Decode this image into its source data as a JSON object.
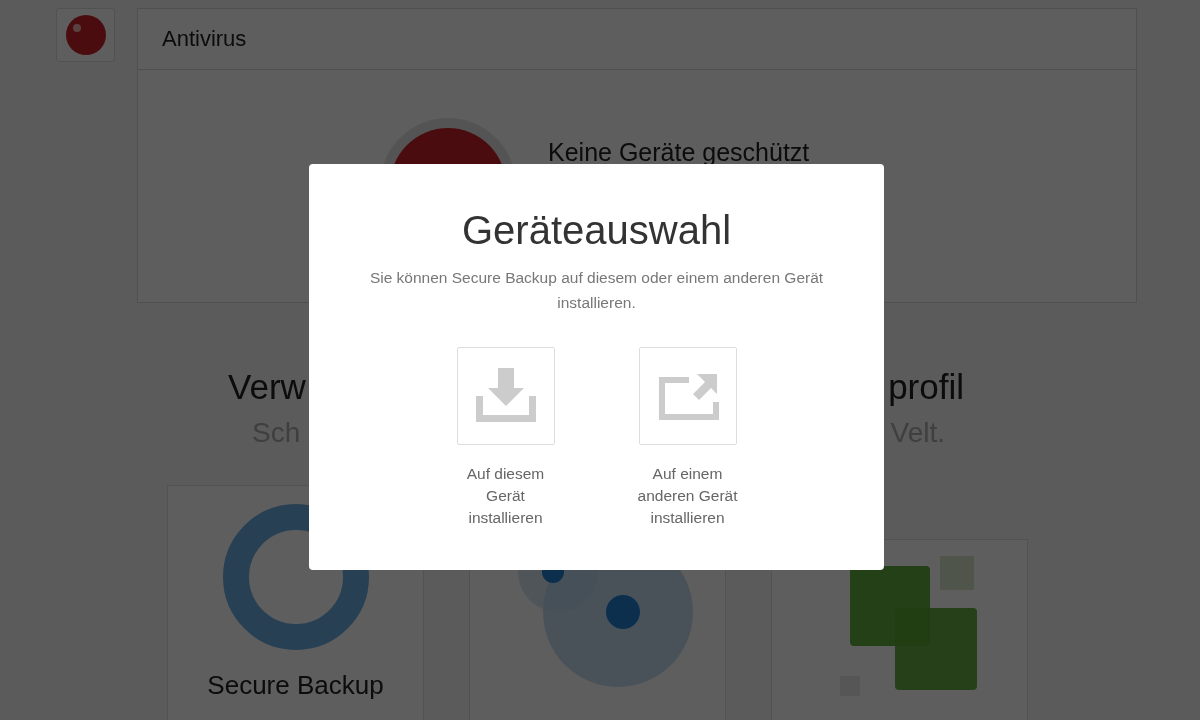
{
  "antivirus_card": {
    "title": "Antivirus",
    "status": "Keine Geräte geschützt"
  },
  "promo": {
    "heading_fragments": [
      "Verw",
      "profil"
    ],
    "subheading_fragments": [
      "Sch",
      "Velt."
    ]
  },
  "product_cards": [
    {
      "kind": "donut",
      "title": "Secure Backup"
    },
    {
      "kind": "bubbles"
    },
    {
      "kind": "squares"
    }
  ],
  "dialog": {
    "title": "Geräteauswahl",
    "description": "Sie können Secure Backup auf diesem oder einem anderen Gerät installieren.",
    "options": [
      {
        "kind": "download",
        "label": "Auf diesem Gerät installieren"
      },
      {
        "kind": "share",
        "label": "Auf einem anderen Gerät installieren"
      }
    ]
  }
}
